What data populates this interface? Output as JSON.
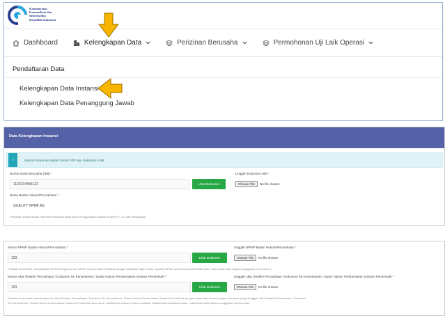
{
  "brand": {
    "lines": [
      "Kementerian",
      "Komunikasi dan",
      "Informatika",
      "Republik Indonesia"
    ],
    "colors": {
      "primary": "#2a3f8f",
      "accent": "#29a8e0"
    }
  },
  "annotations": {
    "arrow_color": "#f7b500"
  },
  "nav": {
    "items": [
      {
        "label": "Dashboard",
        "icon": "home-icon"
      },
      {
        "label": "Kelengkapan Data",
        "icon": "building-icon"
      },
      {
        "label": "Perizinan Berusaha",
        "icon": "layers-icon"
      },
      {
        "label": "Permohonan Uji Laik Operasi",
        "icon": "layers-icon"
      }
    ]
  },
  "dropdown": {
    "heading": "Pendaftaran Data",
    "items": [
      "Kelengkapan Data Instansi",
      "Kelengkapan Data Penanggung Jawab"
    ]
  },
  "form_top": {
    "header": "Data Kelengkapan Instansi",
    "info_badge": "i",
    "info_text": "Seluruh Dokumen dalam format PDF dan maksimal 5 MB",
    "nib": {
      "label": "Nomor Induk Berusaha (NIB) *",
      "value": "1122334455123",
      "button": "Lihat Dokumen"
    },
    "nib_upload": {
      "label": "Unggah Dokumen NIB *",
      "button": "Choose File",
      "status": "No file chosen"
    },
    "badan_hukum": {
      "label": "Nama Badan Hukum/Perusahaan *",
      "value": "QUALITY NPMF AS"
    },
    "badan_hukum_hint": "Penulisan Nama Badan Hukum/Perusahaan tidak perlu menggunakan awalan seperti PT, CV, dan sebagainya"
  },
  "form_bottom": {
    "npwp": {
      "label": "Nomor NPWP Badan Hukum/Perusahaan *",
      "value": "123",
      "button": "Lihat Dokumen"
    },
    "npwp_upload": {
      "label": "Unggah NPWP Badan Hukum/Perusahaan *",
      "button": "Choose File",
      "status": "No file chosen"
    },
    "npwp_hint": "Pastikan Anda telah memasukkan NPWP dengan benar. NPWP instansi akan divalidasi dengan database Ditjen Pajak. Apabila NPWP perusahaan Anda tidak valid, maka Anda tidak dapat mengajukan permohonan.",
    "akta": {
      "label": "Nomor Akta Terakhir Perusahaan / Dokumen SK Kementerian / Dasar Hukum Pembentukan Instansi Pemerintah *",
      "value": "123",
      "button": "Lihat Dokumen"
    },
    "akta_upload": {
      "label": "Unggah Akta Terakhir Perusahaan / Dokumen SK Kementerian / Dasar Hukum Pembentukan Instansi Pemerintah *",
      "button": "Choose File",
      "status": "No file chosen"
    },
    "akta_hint_1": "Pastikan Anda telah memasukkan No Akta Terakhir Perusahaan / Dokumen SK Kementerian / Dasar Hukum Pembentukan Instansi Pemerintah dengan benar dan sesuai dengan dokumen yang diunggah. Akta Terakhir Perusahaan / Dokumen",
    "akta_hint_2": "SK Kementerian / Dasar Hukum Pembentukan Instansi Pemerintah akan dicek validitasnya selama proses verifikasi. Apabila ada ketidaksesuaian, maka Anda tidak dapat mengajukan permohonan."
  }
}
